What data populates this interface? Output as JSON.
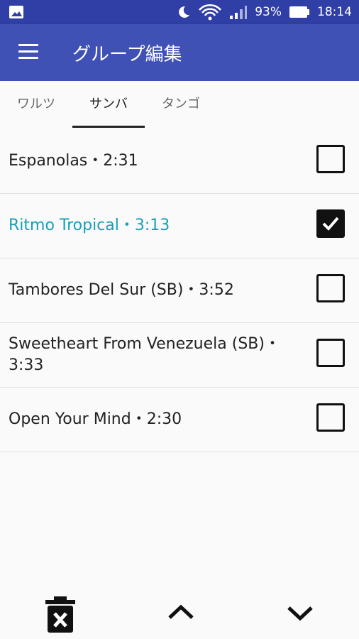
{
  "status_bar": {
    "battery": "93%",
    "time": "18:14",
    "icons": [
      "image-icon",
      "moon-icon",
      "wifi-icon",
      "signal-icon",
      "battery-icon"
    ]
  },
  "app_bar": {
    "title": "グループ編集",
    "menu_icon": "hamburger-menu-icon"
  },
  "tabs": [
    {
      "label": "ワルツ",
      "active": false
    },
    {
      "label": "サンバ",
      "active": true
    },
    {
      "label": "タンゴ",
      "active": false
    }
  ],
  "songs": [
    {
      "label": "Espanolas・2:31",
      "checked": false
    },
    {
      "label": "Ritmo Tropical・3:13",
      "checked": true
    },
    {
      "label": "Tambores Del Sur (SB)・3:52",
      "checked": false
    },
    {
      "label": "Sweetheart From Venezuela (SB)・3:33",
      "checked": false
    },
    {
      "label": "Open Your Mind・2:30",
      "checked": false
    }
  ],
  "bottom_bar": {
    "icons": [
      "delete-icon",
      "chevron-up-icon",
      "chevron-down-icon"
    ]
  },
  "colors": {
    "status_bar": "#2f3fa5",
    "app_bar": "#3f51b5",
    "selected_text": "#1a9fb5",
    "background": "#fafafa"
  }
}
